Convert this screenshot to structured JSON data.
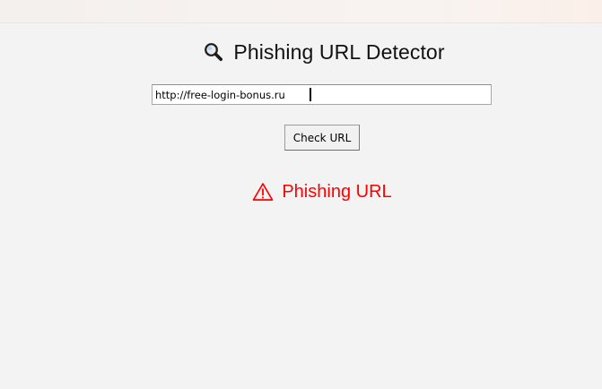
{
  "app": {
    "title": "Phishing URL Detector",
    "title_icon": "magnifier-icon"
  },
  "form": {
    "url_value": "http://free-login-bonus.ru",
    "check_button_label": "Check URL"
  },
  "result": {
    "icon": "warning-icon",
    "text": "Phishing URL",
    "color": "#ff0000"
  }
}
